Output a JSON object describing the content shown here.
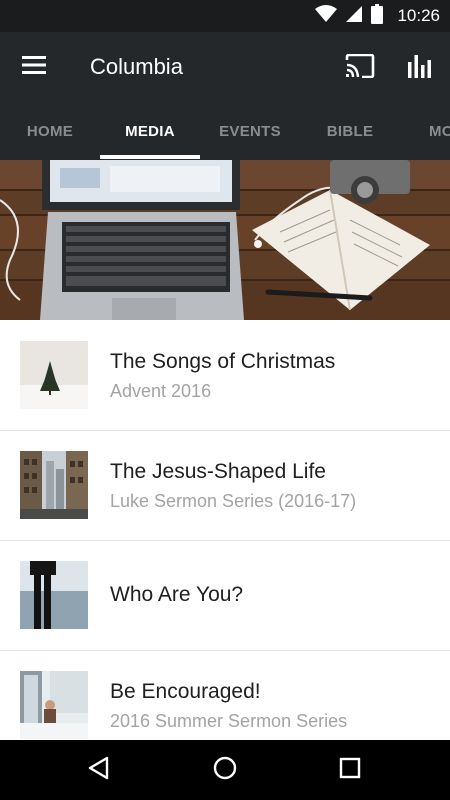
{
  "status_bar": {
    "time": "10:26",
    "icons": [
      "wifi-icon",
      "cellular-icon",
      "battery-icon"
    ]
  },
  "app_bar": {
    "title": "Columbia",
    "icons": [
      "menu-icon",
      "cast-icon",
      "bar-chart-icon"
    ]
  },
  "tabs": [
    {
      "label": "HOME",
      "active": false
    },
    {
      "label": "MEDIA",
      "active": true
    },
    {
      "label": "EVENTS",
      "active": false
    },
    {
      "label": "BIBLE",
      "active": false
    },
    {
      "label": "MO",
      "active": false
    }
  ],
  "hero": {
    "image": "laptop-and-notebook-on-desk"
  },
  "media_list": [
    {
      "title": "The Songs of Christmas",
      "subtitle": "Advent 2016",
      "thumb": "snowy-tree"
    },
    {
      "title": "The Jesus-Shaped Life",
      "subtitle": "Luke Sermon Series (2016-17)",
      "thumb": "city-street"
    },
    {
      "title": "Who Are You?",
      "subtitle": "",
      "thumb": "person-by-water"
    },
    {
      "title": "Be Encouraged!",
      "subtitle": "2016 Summer Sermon Series",
      "thumb": "window-portrait"
    }
  ],
  "nav_bar": {
    "icons": [
      "back-icon",
      "home-icon",
      "recents-icon"
    ]
  },
  "colors": {
    "status_bar": "#1a1c1e",
    "app_bar": "#25282b",
    "tab_active": "#ffffff",
    "tab_inactive": "#8a8d90",
    "subtitle": "#a3a3a3"
  }
}
